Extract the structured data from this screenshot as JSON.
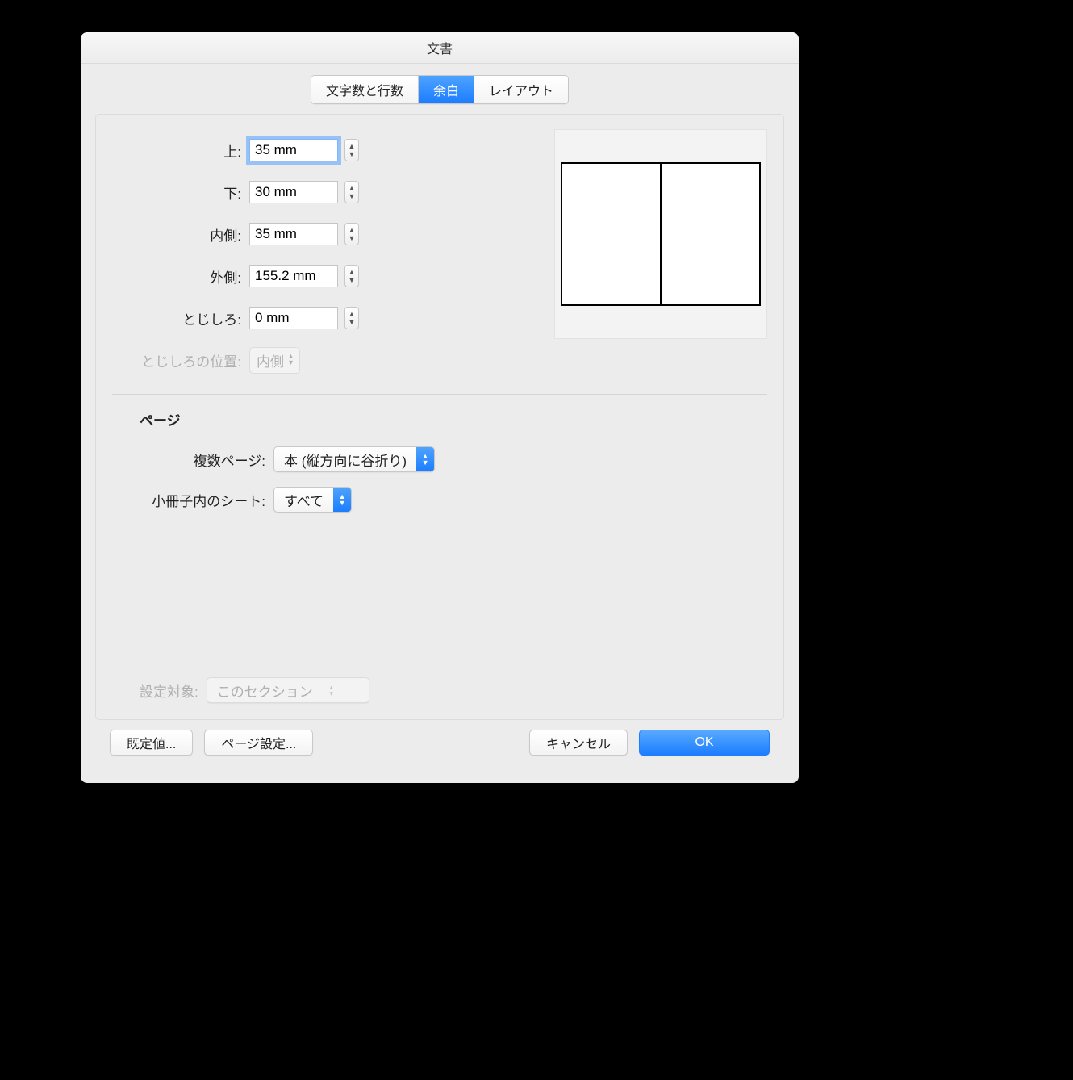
{
  "window": {
    "title": "文書"
  },
  "tabs": [
    {
      "label": "文字数と行数",
      "active": false
    },
    {
      "label": "余白",
      "active": true
    },
    {
      "label": "レイアウト",
      "active": false
    }
  ],
  "margins": {
    "top": {
      "label": "上:",
      "value": "35 mm"
    },
    "bottom": {
      "label": "下:",
      "value": "30 mm"
    },
    "inside": {
      "label": "内側:",
      "value": "35 mm"
    },
    "outside": {
      "label": "外側:",
      "value": "155.2 mm"
    },
    "gutter": {
      "label": "とじしろ:",
      "value": "0 mm"
    },
    "gutter_pos": {
      "label": "とじしろの位置:",
      "value": "内側"
    }
  },
  "page_section": {
    "title": "ページ",
    "multi_pages": {
      "label": "複数ページ:",
      "value": "本 (縦方向に谷折り)"
    },
    "booklet_sheets": {
      "label": "小冊子内のシート:",
      "value": "すべて"
    }
  },
  "apply_to": {
    "label": "設定対象:",
    "value": "このセクション"
  },
  "buttons": {
    "default": "既定値...",
    "page_setup": "ページ設定...",
    "cancel": "キャンセル",
    "ok": "OK"
  }
}
